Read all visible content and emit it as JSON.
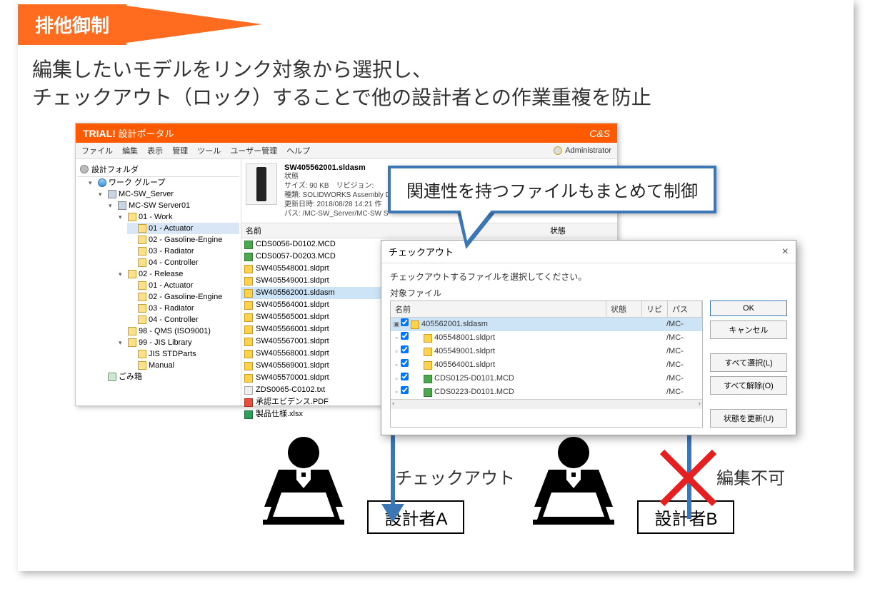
{
  "title": "排他御制",
  "description_line1": "編集したいモデルをリンク対象から選択し、",
  "description_line2": "チェックアウト（ロック）することで他の設計者との作業重複を防止",
  "app": {
    "brand": "TRIAL!",
    "subtitle": "設計ポータル",
    "logo": "C&S",
    "menus": [
      "ファイル",
      "編集",
      "表示",
      "管理",
      "ツール",
      "ユーザー管理",
      "ヘルプ"
    ],
    "user": "Administrator"
  },
  "tree": {
    "header": "設計フォルダ",
    "root": "ワーク グループ",
    "server_group": "MC-SW_Server",
    "server": "MC-SW Server01",
    "work": "01 - Work",
    "work_items": [
      "01 - Actuator",
      "02 - Gasoline-Engine",
      "03 - Radiator",
      "04 - Controller"
    ],
    "release": "02 - Release",
    "release_items": [
      "01 - Actuator",
      "02 - Gasoline-Engine",
      "03 - Radiator",
      "04 - Controller"
    ],
    "qms": "98 - QMS (ISO9001)",
    "jis": "99 - JIS Library",
    "jis_items": [
      "JIS STDParts",
      "Manual"
    ],
    "trash": "ごみ箱"
  },
  "preview": {
    "filename": "SW405562001.sldasm",
    "status_label": "状態",
    "size": "サイズ: 90 KB　リビジョン:",
    "type": "種類: SOLIDWORKS Assembly D",
    "date": "更新日時: 2018/08/28 14:21 作",
    "path": "パス: /MC-SW_Server/MC-SW S"
  },
  "list": {
    "col_name": "名前",
    "col_status": "状態",
    "files": [
      {
        "icon": "green",
        "name": "CDS0056-D0102.MCD"
      },
      {
        "icon": "green",
        "name": "CDS0057-D0203.MCD"
      },
      {
        "icon": "yellow",
        "name": "SW405548001.sldprt"
      },
      {
        "icon": "yellow",
        "name": "SW405549001.sldprt"
      },
      {
        "icon": "yellow",
        "name": "SW405562001.sldasm",
        "sel": true
      },
      {
        "icon": "yellow",
        "name": "SW405564001.sldprt"
      },
      {
        "icon": "yellow",
        "name": "SW405565001.sldprt"
      },
      {
        "icon": "yellow",
        "name": "SW405566001.sldprt"
      },
      {
        "icon": "yellow",
        "name": "SW405567001.sldprt"
      },
      {
        "icon": "yellow",
        "name": "SW405568001.sldprt"
      },
      {
        "icon": "yellow",
        "name": "SW405569001.sldprt"
      },
      {
        "icon": "yellow",
        "name": "SW405570001.sldprt"
      },
      {
        "icon": "txt",
        "name": "ZDS0065-C0102.txt"
      },
      {
        "icon": "pdf",
        "name": "承認エビデンス.PDF"
      },
      {
        "icon": "xls",
        "name": "製品仕様.xlsx"
      }
    ]
  },
  "callout": "関連性を持つファイルもまとめて制御",
  "dialog": {
    "title": "チェックアウト",
    "instruction": "チェックアウトするファイルを選択してください。",
    "sub": "対象ファイル",
    "col_name": "名前",
    "col_status": "状態",
    "col_rev": "リビ",
    "col_path": "パス",
    "rows": [
      {
        "level": 0,
        "icon": "yellow",
        "name": "405562001.sldasm",
        "path": "/MC-",
        "sel": true
      },
      {
        "level": 1,
        "icon": "yellow",
        "name": "405548001.sldprt",
        "path": "/MC-"
      },
      {
        "level": 1,
        "icon": "yellow",
        "name": "405549001.sldprt",
        "path": "/MC-"
      },
      {
        "level": 1,
        "icon": "yellow",
        "name": "405564001.sldprt",
        "path": "/MC-"
      },
      {
        "level": 1,
        "icon": "green",
        "name": "CDS0125-D0101.MCD",
        "path": "/MC-"
      },
      {
        "level": 1,
        "icon": "green",
        "name": "CDS0223-D0101.MCD",
        "path": "/MC-"
      }
    ],
    "buttons": {
      "ok": "OK",
      "cancel": "キャンセル",
      "select_all": "すべて選択(L)",
      "deselect_all": "すべて解除(O)",
      "refresh": "状態を更新(U)"
    }
  },
  "designer_a": "設計者A",
  "designer_b": "設計者B",
  "label_checkout": "チェックアウト",
  "label_noedit": "編集不可"
}
